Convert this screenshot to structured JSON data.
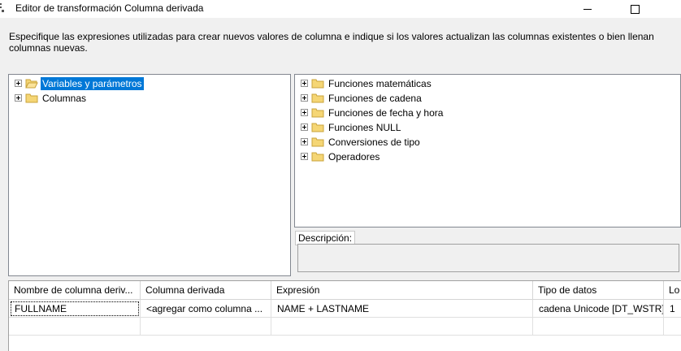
{
  "window": {
    "title": "Editor de transformación Columna derivada",
    "minimize_icon": "minimize-icon",
    "maximize_icon": "maximize-icon"
  },
  "instructions": "Especifique las expresiones utilizadas para crear nuevos valores de columna e indique si los valores actualizan las columnas existentes o bien llenan columnas nuevas.",
  "left_tree": {
    "items": [
      {
        "label": "Variables y parámetros",
        "icon": "folder-open-icon",
        "selected": true
      },
      {
        "label": "Columnas",
        "icon": "folder-icon",
        "selected": false
      }
    ]
  },
  "right_tree": {
    "items": [
      {
        "label": "Funciones matemáticas",
        "icon": "folder-icon"
      },
      {
        "label": "Funciones de cadena",
        "icon": "folder-icon"
      },
      {
        "label": "Funciones de fecha y hora",
        "icon": "folder-icon"
      },
      {
        "label": "Funciones NULL",
        "icon": "folder-icon"
      },
      {
        "label": "Conversiones de tipo",
        "icon": "folder-icon"
      },
      {
        "label": "Operadores",
        "icon": "folder-icon"
      }
    ]
  },
  "description": {
    "label": "Descripción:",
    "value": ""
  },
  "grid": {
    "columns": [
      "Nombre de columna deriv...",
      "Columna derivada",
      "Expresión",
      "Tipo de datos",
      "Lo"
    ],
    "rows": [
      [
        "FULLNAME",
        "<agregar como columna ...",
        "NAME + LASTNAME",
        "cadena Unicode [DT_WSTR]",
        "1"
      ]
    ]
  },
  "colors": {
    "selection": "#0078d7",
    "folder": "#f5d675",
    "folder_edge": "#c9a33a"
  }
}
